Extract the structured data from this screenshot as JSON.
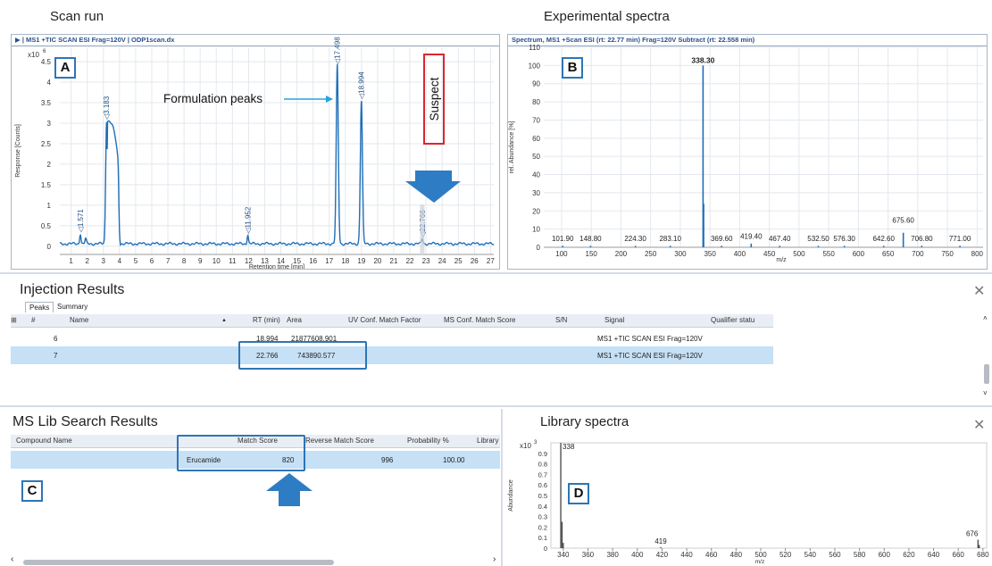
{
  "scan_run": {
    "section_title": "Scan run",
    "header": "▶ | MS1 +TIC SCAN ESI Frag=120V | ODP1scan.dx",
    "scale_label": "x10",
    "scale_exp": "6",
    "ylabel": "Response [Counts]",
    "xlabel": "Retention time [min]",
    "badge": "A",
    "annotation": "Formulation peaks",
    "suspect_label": "Suspect",
    "accent": "#2e75b6",
    "suspect_border": "#d9272d",
    "peak_labels": [
      "1.571",
      "3.183",
      "11.952",
      "17.498",
      "18.994",
      "22.766"
    ]
  },
  "experimental": {
    "section_title": "Experimental spectra",
    "header": "Spectrum, MS1 +Scan ESI (rt: 22.77 min) Frag=120V Subtract (rt: 22.558 min)",
    "ylabel": "rel. Abundance [%]",
    "xlabel": "m/z",
    "badge": "B"
  },
  "injection": {
    "title": "Injection Results",
    "tabs": [
      "Peaks",
      "Summary"
    ],
    "columns": [
      "#",
      "Name",
      "RT (min)",
      "Area",
      "UV Conf. Match Factor",
      "MS Conf. Match Score",
      "S/N",
      "Signal",
      "Qualifier statu"
    ],
    "rows": [
      {
        "num": "6",
        "rt": "18.994",
        "area": "21877608.901",
        "signal": "MS1 +TIC SCAN ESI Frag=120V"
      },
      {
        "num": "7",
        "rt": "22.766",
        "area": "743890.577",
        "signal": "MS1 +TIC SCAN ESI Frag=120V"
      }
    ]
  },
  "lib_search": {
    "title": "MS Lib Search Results",
    "columns": [
      "Compound Name",
      "Match Score",
      "Reverse Match Score",
      "Probability %",
      "Library"
    ],
    "row": {
      "compound": "Erucamide",
      "match": "820",
      "reverse": "996",
      "probability": "100.00"
    },
    "badge": "C"
  },
  "library_spectra": {
    "section_title": "Library spectra",
    "scale_label": "x10",
    "scale_exp": "3",
    "ylabel": "Abundance",
    "xlabel": "m/z",
    "badge": "D"
  },
  "chart_data": [
    {
      "type": "line",
      "name": "Scan run chromatogram",
      "xlabel": "Retention time [min]",
      "ylabel": "Response [Counts]",
      "y_multiplier": "x10^6",
      "xlim": [
        0.3,
        27.2
      ],
      "ylim": [
        -0.2,
        4.85
      ],
      "x_ticks": [
        1,
        2,
        3,
        4,
        5,
        6,
        7,
        8,
        9,
        10,
        11,
        12,
        13,
        14,
        15,
        16,
        17,
        18,
        19,
        20,
        21,
        22,
        23,
        24,
        25,
        26,
        27
      ],
      "y_ticks": [
        0,
        0.5,
        1,
        1.5,
        2,
        2.5,
        3,
        3.5,
        4,
        4.5
      ],
      "peaks": [
        {
          "rt": 1.571,
          "height": 0.25
        },
        {
          "rt": 1.9,
          "height": 0.12
        },
        {
          "rt": 3.183,
          "height": 3.0
        },
        {
          "rt": 11.952,
          "height": 0.22
        },
        {
          "rt": 17.498,
          "height": 4.35
        },
        {
          "rt": 18.994,
          "height": 3.5
        },
        {
          "rt": 22.766,
          "height": 0.13
        }
      ]
    },
    {
      "type": "bar",
      "name": "Experimental spectrum",
      "xlabel": "m/z",
      "ylabel": "rel. Abundance [%]",
      "xlim": [
        70,
        810
      ],
      "ylim": [
        0,
        110
      ],
      "x_ticks": [
        100,
        150,
        200,
        250,
        300,
        350,
        400,
        450,
        500,
        550,
        600,
        650,
        700,
        750,
        800
      ],
      "y_ticks": [
        0,
        10,
        20,
        30,
        40,
        50,
        60,
        70,
        80,
        90,
        100,
        110
      ],
      "peaks": [
        {
          "mz": 101.9,
          "abundance": 0.8
        },
        {
          "mz": 148.8,
          "abundance": 0.8
        },
        {
          "mz": 224.3,
          "abundance": 0.8
        },
        {
          "mz": 283.1,
          "abundance": 0.8
        },
        {
          "mz": 338.3,
          "abundance": 100
        },
        {
          "mz": 339.3,
          "abundance": 24
        },
        {
          "mz": 369.6,
          "abundance": 0.8
        },
        {
          "mz": 419.4,
          "abundance": 2
        },
        {
          "mz": 467.4,
          "abundance": 0.8
        },
        {
          "mz": 532.5,
          "abundance": 0.8
        },
        {
          "mz": 576.3,
          "abundance": 0.8
        },
        {
          "mz": 642.6,
          "abundance": 0.8
        },
        {
          "mz": 675.6,
          "abundance": 8
        },
        {
          "mz": 706.8,
          "abundance": 0.8
        },
        {
          "mz": 771.0,
          "abundance": 0.8
        }
      ],
      "peak_labels": [
        "101.90",
        "148.80",
        "224.30",
        "283.10",
        "338.30",
        "369.60",
        "419.40",
        "467.40",
        "532.50",
        "576.30",
        "642.60",
        "675.60",
        "706.80",
        "771.00"
      ]
    },
    {
      "type": "bar",
      "name": "Library spectrum",
      "xlabel": "m/z",
      "ylabel": "Abundance",
      "y_multiplier": "x10^3",
      "xlim": [
        330,
        683
      ],
      "ylim": [
        0,
        1.0
      ],
      "x_ticks": [
        340,
        360,
        380,
        400,
        420,
        440,
        460,
        480,
        500,
        520,
        540,
        560,
        580,
        600,
        620,
        640,
        660,
        680
      ],
      "y_ticks": [
        0,
        0.1,
        0.2,
        0.3,
        0.4,
        0.5,
        0.6,
        0.7,
        0.8,
        0.9
      ],
      "peaks": [
        {
          "mz": 338,
          "abundance": 0.999
        },
        {
          "mz": 339,
          "abundance": 0.25
        },
        {
          "mz": 340,
          "abundance": 0.05
        },
        {
          "mz": 419,
          "abundance": 0.01
        },
        {
          "mz": 676,
          "abundance": 0.08
        },
        {
          "mz": 677,
          "abundance": 0.03
        }
      ],
      "peak_labels": [
        "338",
        "419",
        "676"
      ]
    }
  ]
}
